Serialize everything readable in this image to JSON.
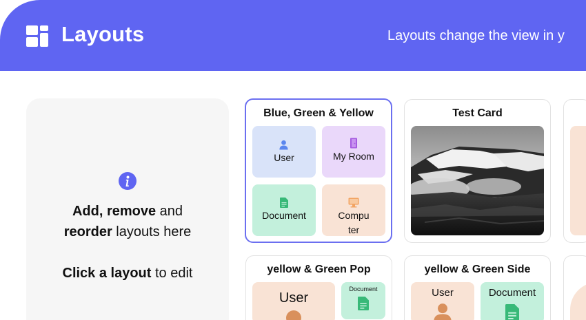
{
  "header": {
    "title": "Layouts",
    "subtitle": "Layouts change the view in y",
    "logo_icon": "layout-grid-icon"
  },
  "info": {
    "icon": "info-icon",
    "add": "Add,",
    "remove": "remove",
    "and": " and",
    "reorder": "reorder",
    "layouts_here": " layouts here",
    "click_layout": "Click a layout",
    "to_edit": " to edit"
  },
  "cards": [
    {
      "title": "Blue, Green & Yellow",
      "selected": true,
      "tiles": [
        {
          "label": "User",
          "icon": "user-icon",
          "color": "#d9e3f9"
        },
        {
          "label": "My Room",
          "icon": "door-icon",
          "color": "#ead8fa"
        },
        {
          "label": "Document",
          "icon": "document-icon",
          "color": "#c3f0dc"
        },
        {
          "label": "Compu",
          "label2": "ter",
          "icon": "computer-icon",
          "color": "#f9e3d5"
        }
      ]
    },
    {
      "title": "Test Card",
      "image": "mountain-landscape-photo"
    },
    {
      "title": "yellow & Green Pop",
      "tiles": [
        {
          "label": "User",
          "icon": "user-icon",
          "color": "#f9e3d5"
        },
        {
          "label": "Document",
          "icon": "document-icon",
          "color": "#c3f0dc"
        }
      ]
    },
    {
      "title": "yellow & Green Side",
      "tiles": [
        {
          "label": "User",
          "icon": "user-icon",
          "color": "#f9e3d5"
        },
        {
          "label": "Document",
          "icon": "document-icon",
          "color": "#c3f0dc"
        }
      ]
    }
  ],
  "colors": {
    "accent": "#5f65f2",
    "selected_border": "#6b6ff0",
    "tile_blue": "#d9e3f9",
    "tile_purple": "#ead8fa",
    "tile_green": "#c3f0dc",
    "tile_peach": "#f9e3d5"
  }
}
